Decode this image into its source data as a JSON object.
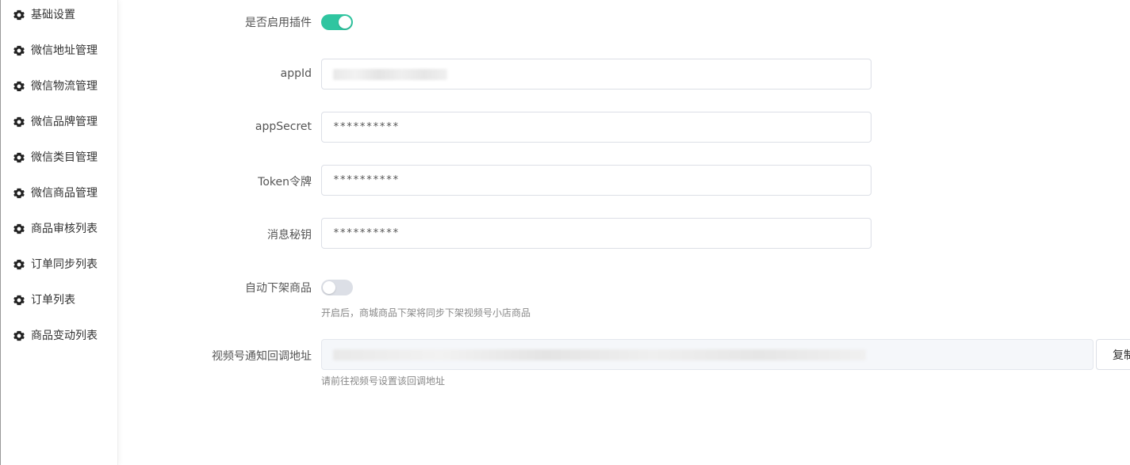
{
  "sidebar": {
    "items": [
      {
        "label": "基础设置"
      },
      {
        "label": "微信地址管理"
      },
      {
        "label": "微信物流管理"
      },
      {
        "label": "微信品牌管理"
      },
      {
        "label": "微信类目管理"
      },
      {
        "label": "微信商品管理"
      },
      {
        "label": "商品审核列表"
      },
      {
        "label": "订单同步列表"
      },
      {
        "label": "订单列表"
      },
      {
        "label": "商品变动列表"
      }
    ],
    "icon": "gear-icon"
  },
  "form": {
    "enable_plugin": {
      "label": "是否启用插件",
      "on": true
    },
    "appid": {
      "label": "appId",
      "value": ""
    },
    "appsecret": {
      "label": "appSecret",
      "value": "**********"
    },
    "token": {
      "label": "Token令牌",
      "value": "**********"
    },
    "aeskey": {
      "label": "消息秘钥",
      "value": "**********"
    },
    "auto_offshelf": {
      "label": "自动下架商品",
      "on": false,
      "hint": "开启后，商城商品下架将同步下架视频号小店商品"
    },
    "callback_url": {
      "label": "视频号通知回调地址",
      "value": "",
      "hint": "请前往视频号设置该回调地址",
      "copy_label": "复制"
    }
  },
  "colors": {
    "switch_on": "#2fc5a0",
    "switch_off": "#dcdfe6"
  }
}
